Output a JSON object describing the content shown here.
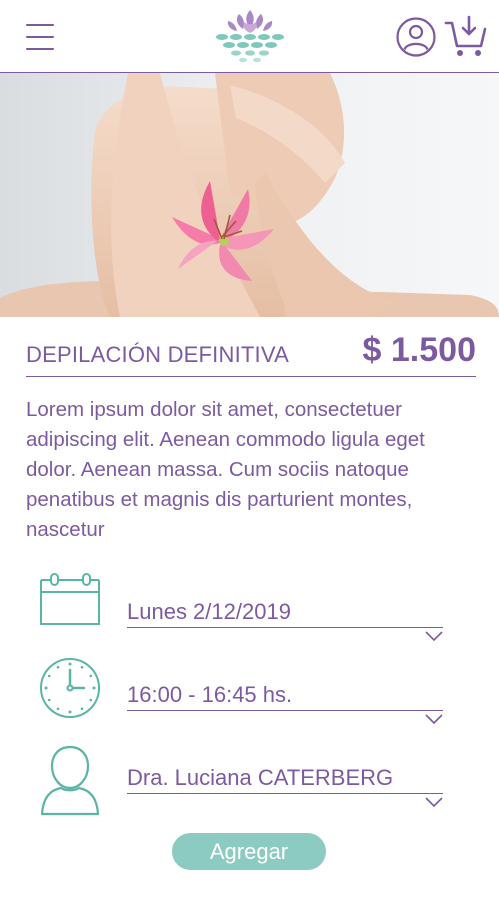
{
  "header": {
    "menu_icon": "hamburger-menu-icon",
    "logo_icon": "lotus-logo-icon",
    "user_icon": "user-account-icon",
    "cart_icon": "cart-add-icon"
  },
  "product": {
    "title": "DEPILACIÓN DEFINITIVA",
    "price": "$ 1.500",
    "description": "Lorem ipsum dolor sit amet, consectetuer adipiscing elit. Aenean commodo ligula eget dolor. Aenean massa. Cum sociis natoque penatibus et magnis dis parturient montes, nascetur"
  },
  "booking": {
    "date": "Lunes 2/12/2019",
    "time": "16:00 - 16:45 hs.",
    "professional": "Dra. Luciana CATERBERG",
    "add_button": "Agregar"
  },
  "colors": {
    "primary": "#7d5aa0",
    "accent": "#5bb5a7",
    "button": "#8ccbc1"
  }
}
